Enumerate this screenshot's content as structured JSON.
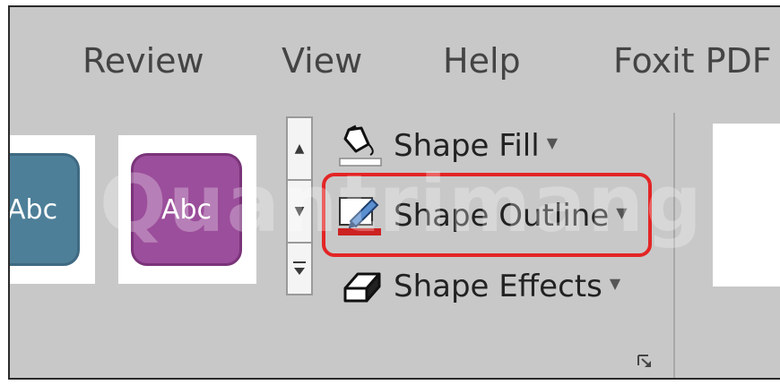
{
  "tabs": [
    {
      "label": "Review"
    },
    {
      "label": "View"
    },
    {
      "label": "Help"
    },
    {
      "label": "Foxit PDF"
    }
  ],
  "gallery": {
    "thumbs": [
      {
        "label": "Abc",
        "fill": "#4e7f98"
      },
      {
        "label": "Abc",
        "fill": "#9b4e9b"
      }
    ]
  },
  "shape_commands": {
    "fill": {
      "label": "Shape Fill",
      "icon": "paint-bucket-icon"
    },
    "outline": {
      "label": "Shape Outline",
      "icon": "pen-outline-icon",
      "highlighted": true,
      "highlight_color": "#e32525"
    },
    "effects": {
      "label": "Shape Effects",
      "icon": "shape-effects-icon"
    }
  },
  "watermark": {
    "text": "Quantrimang"
  },
  "colors": {
    "ribbon_bg": "#c8c8c8",
    "outline_red": "#cc2222"
  }
}
